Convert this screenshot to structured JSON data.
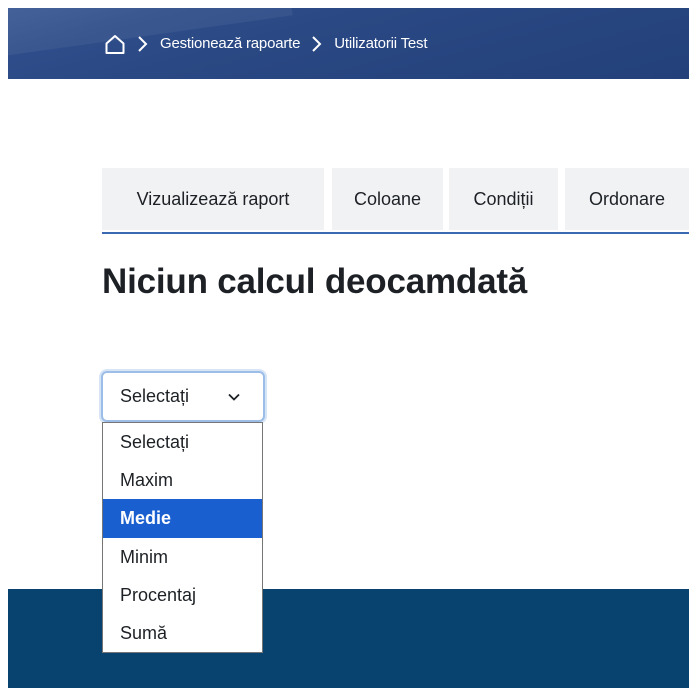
{
  "breadcrumb": {
    "home_icon": "home-icon",
    "items": [
      "Gestionează rapoarte",
      "Utilizatorii Test"
    ]
  },
  "tabs": [
    {
      "label": "Vizualizează raport"
    },
    {
      "label": "Coloane"
    },
    {
      "label": "Condiții"
    },
    {
      "label": "Ordonare"
    }
  ],
  "main": {
    "heading": "Niciun calcul deocamdată"
  },
  "select": {
    "current_value": "Selectați",
    "options": [
      "Selectați",
      "Maxim",
      "Medie",
      "Minim",
      "Procentaj",
      "Sumă"
    ],
    "highlighted": "Medie"
  },
  "colors": {
    "topbar": "#2c4a86",
    "footer": "#08426e",
    "tab_underline": "#3a6bb2",
    "option_highlight": "#1a5fcf"
  }
}
